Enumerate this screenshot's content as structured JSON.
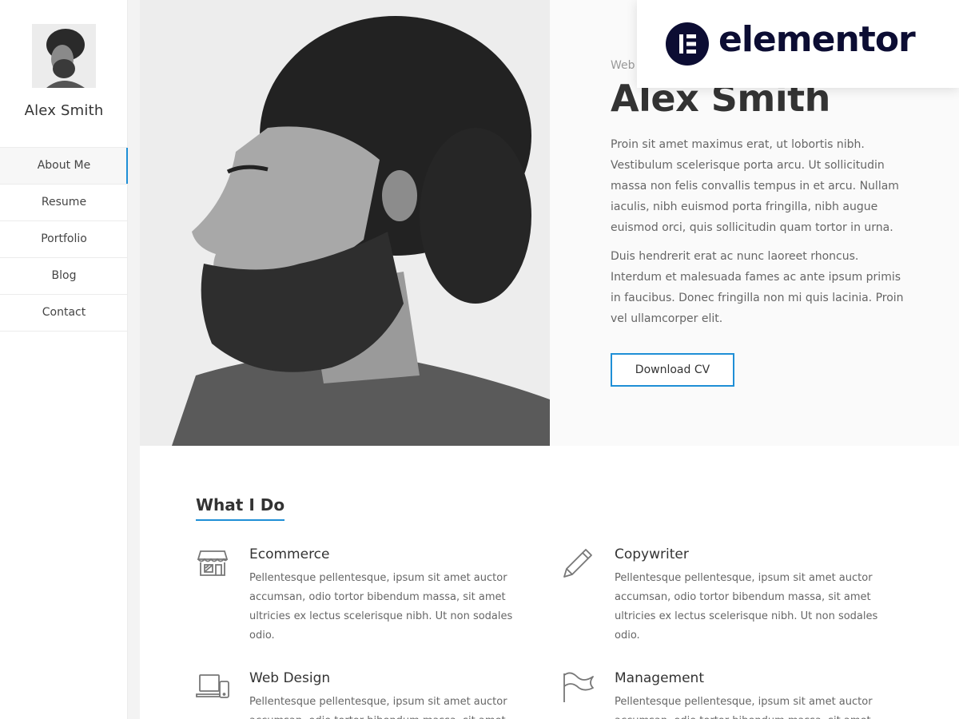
{
  "sidebar": {
    "name": "Alex Smith",
    "nav": [
      {
        "label": "About Me",
        "active": true
      },
      {
        "label": "Resume",
        "active": false
      },
      {
        "label": "Portfolio",
        "active": false
      },
      {
        "label": "Blog",
        "active": false
      },
      {
        "label": "Contact",
        "active": false
      }
    ]
  },
  "hero": {
    "eyebrow": "Web",
    "title": "Alex Smith",
    "paragraph1": "Proin sit amet maximus erat, ut lobortis nibh. Vestibulum scelerisque porta arcu. Ut sollicitudin massa non felis convallis tempus in et arcu. Nullam iaculis, nibh euismod porta fringilla, nibh augue euismod orci, quis sollicitudin quam tortor in urna.",
    "paragraph2": "Duis hendrerit erat ac nunc laoreet rhoncus. Interdum et malesuada fames ac ante ipsum primis in faucibus. Donec fringilla non mi quis lacinia. Proin vel ullamcorper elit.",
    "cta_label": "Download CV"
  },
  "badge": {
    "text": "elementor"
  },
  "what_i_do": {
    "title": "What I Do",
    "services": [
      {
        "icon": "shop-icon",
        "title": "Ecommerce",
        "description": "Pellentesque pellentesque, ipsum sit amet auctor accumsan, odio tortor bibendum massa, sit amet ultricies ex lectus scelerisque nibh. Ut non sodales odio."
      },
      {
        "icon": "pencil-icon",
        "title": "Copywriter",
        "description": "Pellentesque pellentesque, ipsum sit amet auctor accumsan, odio tortor bibendum massa, sit amet ultricies ex lectus scelerisque nibh. Ut non sodales odio."
      },
      {
        "icon": "devices-icon",
        "title": "Web Design",
        "description": "Pellentesque pellentesque, ipsum sit amet auctor accumsan, odio tortor bibendum massa, sit amet"
      },
      {
        "icon": "flag-icon",
        "title": "Management",
        "description": "Pellentesque pellentesque, ipsum sit amet auctor accumsan, odio tortor bibendum massa, sit amet"
      }
    ]
  },
  "colors": {
    "accent": "#1f8fd6",
    "brand_dark": "#0c0d33",
    "text": "#333333",
    "muted": "#666666"
  }
}
